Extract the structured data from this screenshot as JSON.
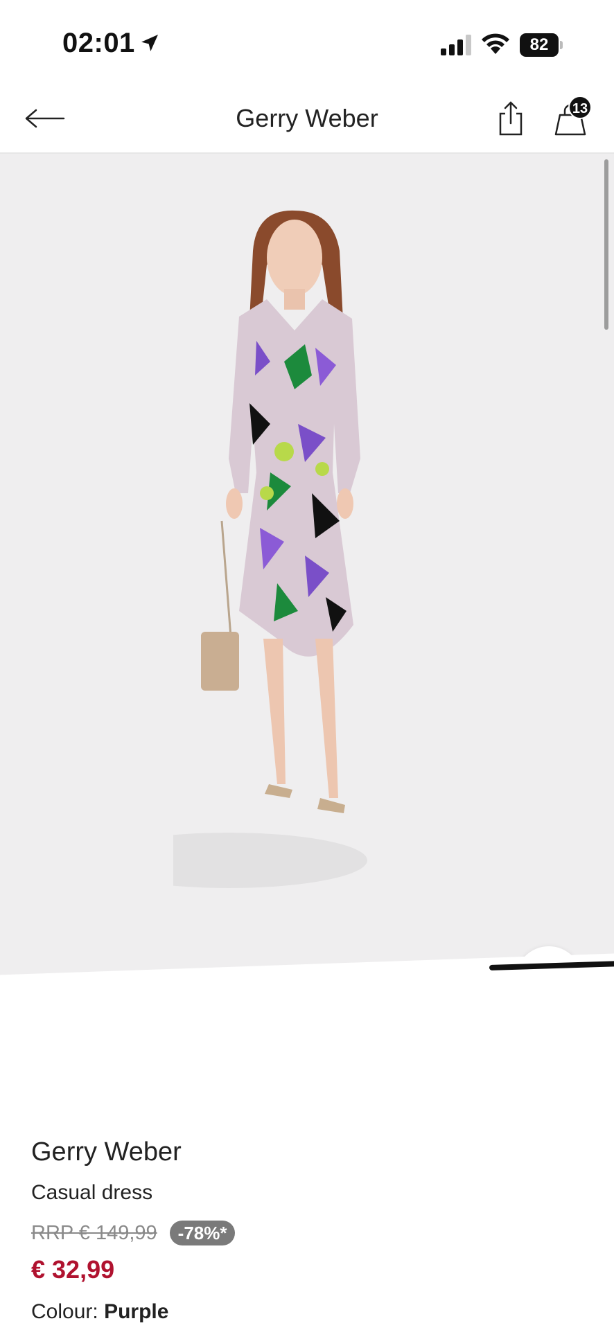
{
  "status_bar": {
    "time": "02:01",
    "battery": "82"
  },
  "header": {
    "title": "Gerry Weber",
    "cart_count": "13"
  },
  "product": {
    "brand": "Gerry Weber",
    "name": "Casual dress",
    "rrp_price": "RRP € 149,99",
    "discount": "-78%*",
    "sale_price": "€ 32,99",
    "colour_label": "Colour:",
    "colour_value": "Purple"
  },
  "colors": {
    "sale_price": "#b0122f",
    "discount_badge": "#7a7a7a",
    "gallery_bg": "#efeeef",
    "dark_button": "#1e1e1e"
  },
  "icons": {
    "back": "arrow-left-icon",
    "share": "share-icon",
    "bag": "shopping-bag-icon",
    "wishlist": "heart-icon",
    "add_to_bag": "bag-plus-icon"
  }
}
